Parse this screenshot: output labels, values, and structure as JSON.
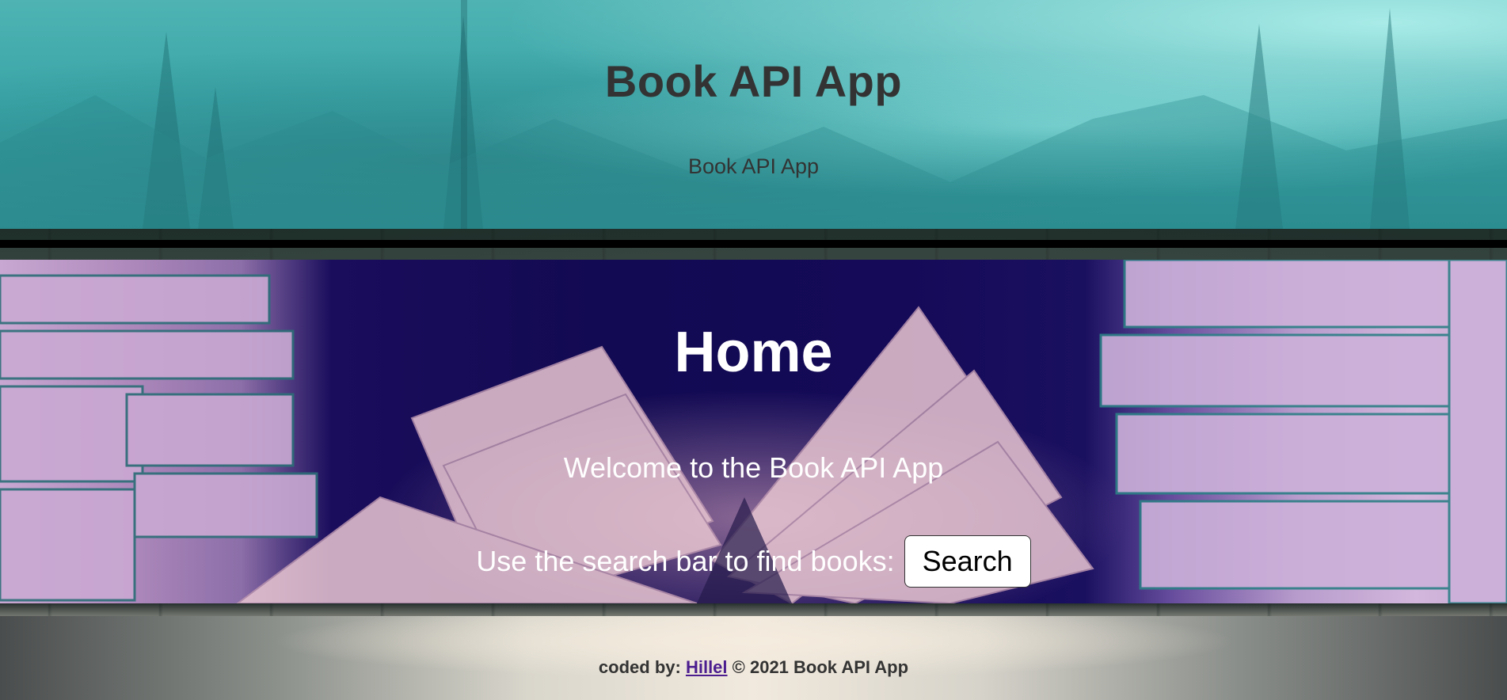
{
  "header": {
    "title": "Book API App",
    "subtitle": "Book API App"
  },
  "main": {
    "heading": "Home",
    "welcome": "Welcome to the Book API App",
    "search_prompt": "Use the search bar to find books:",
    "search_button_label": "Search"
  },
  "footer": {
    "prefix": "coded by:",
    "author_link": "Hillel",
    "suffix": "© 2021 Book API App"
  },
  "colors": {
    "header_bg": "#3aa5a7",
    "heading_text": "#333333",
    "main_text": "#ffffff",
    "link": "#4b1d8f"
  }
}
